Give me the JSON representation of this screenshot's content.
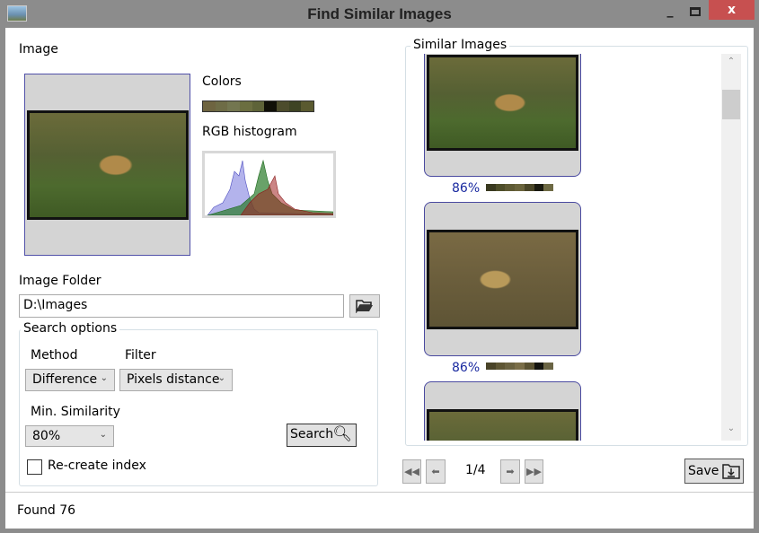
{
  "window": {
    "title": "Find Similar Images",
    "minimize": "_",
    "close": "x"
  },
  "left": {
    "image_label": "Image",
    "colors_label": "Colors",
    "colors": [
      "#6e6440",
      "#6e6c46",
      "#737650",
      "#6b6e40",
      "#5e6338",
      "#101008",
      "#4c4c2c",
      "#3e4424",
      "#5a5a30"
    ],
    "histogram_label": "RGB histogram",
    "folder_label": "Image Folder",
    "folder_value": "D:\\Images",
    "search_options": {
      "title": "Search options",
      "method_label": "Method",
      "method_value": "Difference",
      "filter_label": "Filter",
      "filter_value": "Pixels distance",
      "min_similarity_label": "Min. Similarity",
      "min_similarity_value": "80%",
      "search_button": "Search",
      "recreate_label": "Re-create index",
      "recreate_checked": false
    }
  },
  "right": {
    "title": "Similar Images",
    "results": [
      {
        "similarity": "86%",
        "colors": [
          "#3a3a20",
          "#4e4e2a",
          "#5e5a34",
          "#6a643c",
          "#4a4628",
          "#1a1a10",
          "#6e6a44"
        ]
      },
      {
        "similarity": "86%",
        "colors": [
          "#4a4428",
          "#5e5634",
          "#6a6240",
          "#7a6e48",
          "#5a5232",
          "#141410",
          "#6a6444"
        ]
      }
    ],
    "page": "1/4",
    "save_button": "Save"
  },
  "status": {
    "text": "Found 76"
  }
}
